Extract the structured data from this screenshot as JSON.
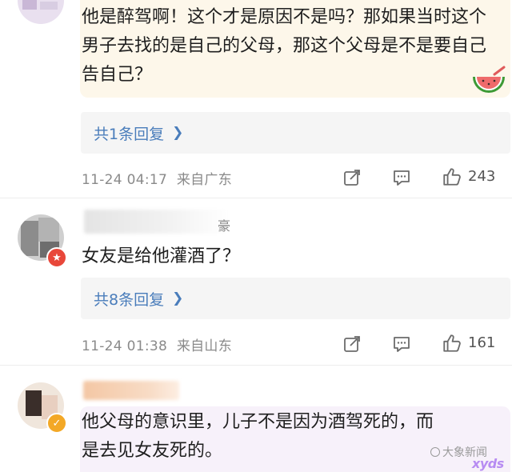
{
  "comments": [
    {
      "text": "他是醉驾啊！这个才是原因不是吗？那如果当时这个男子去找的是自己的父母，那这个父母是不是要自己告自己？",
      "reply_label": "共1条回复",
      "timestamp": "11-24 04:17",
      "location": "来自广东",
      "likes": "243",
      "sticker": "watermelon-emoji"
    },
    {
      "username_tail": "豪",
      "text": "女友是给他灌酒了？",
      "reply_label": "共8条回复",
      "timestamp": "11-24 01:38",
      "location": "来自山东",
      "likes": "161",
      "badge": "red-verified"
    },
    {
      "text": "他父母的意识里，儿子不是因为酒驾死的，而是去见女友死的。",
      "badge": "gold-verified"
    }
  ],
  "watermark": {
    "source": "大象新闻",
    "tag": "xyds"
  },
  "icons": {
    "share": "share-icon",
    "comment": "comment-icon",
    "like": "like-icon"
  },
  "colors": {
    "link_blue": "#4a7dbb",
    "meta_gray": "#8a8a8a",
    "highlight_card": "#fdf7ea"
  }
}
